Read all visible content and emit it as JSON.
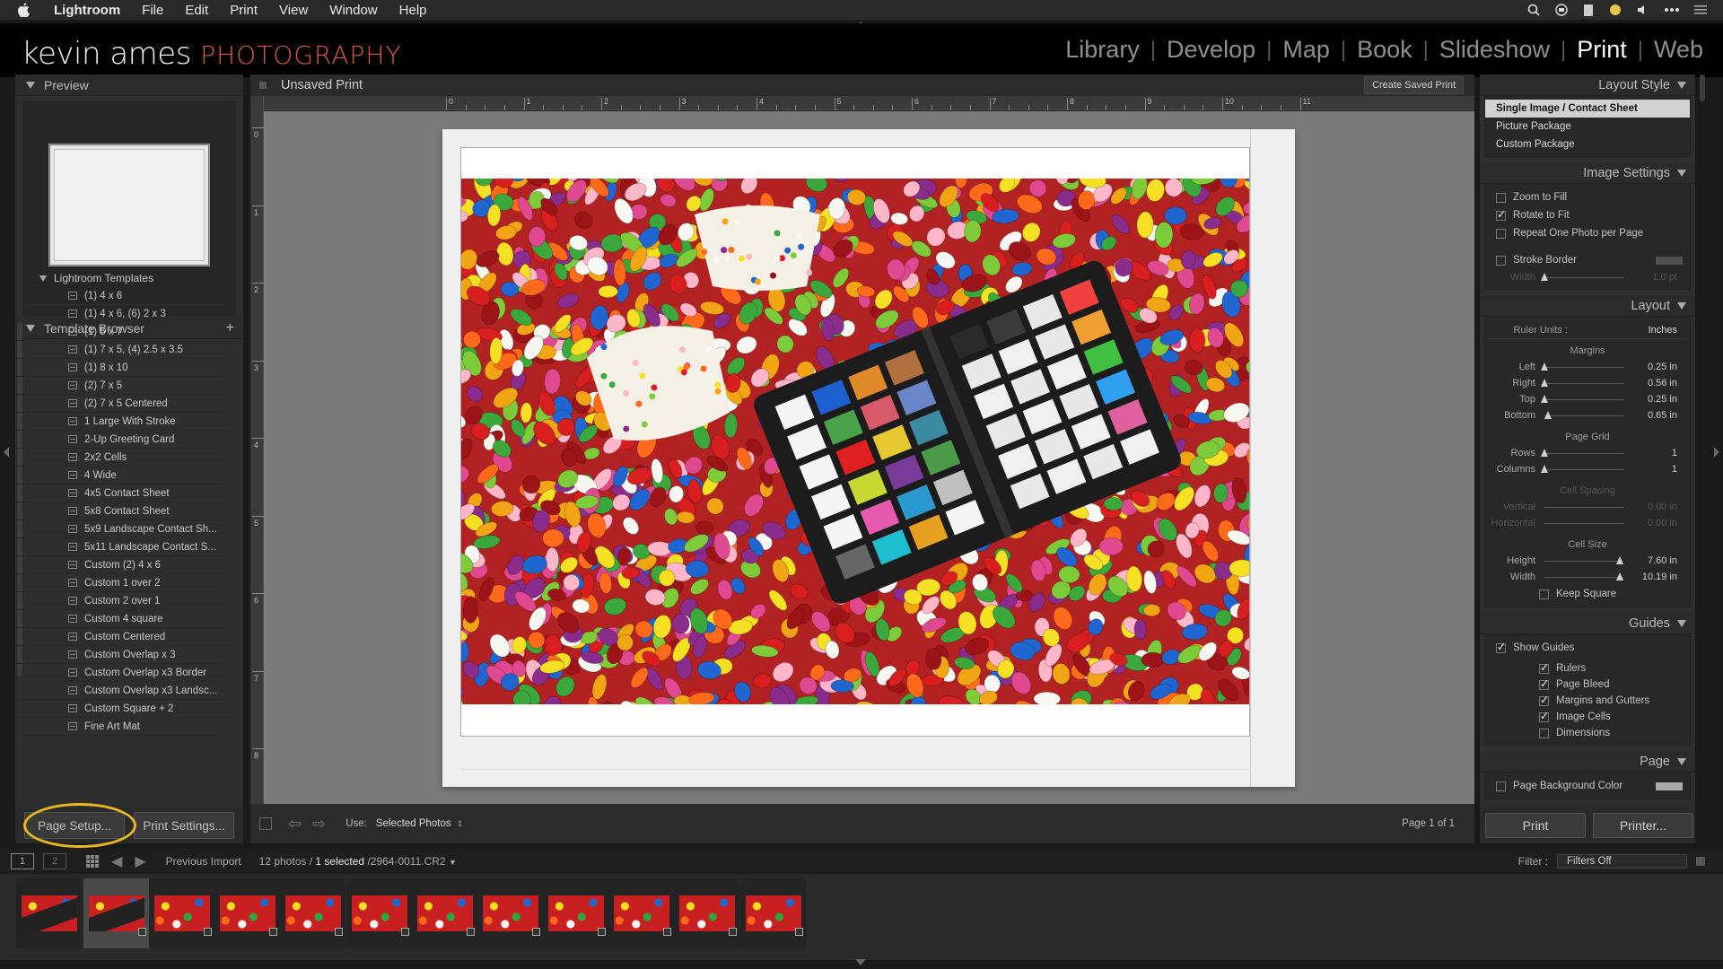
{
  "menubar": {
    "apple": "apple-icon",
    "items": [
      "Lightroom",
      "File",
      "Edit",
      "Print",
      "View",
      "Window",
      "Help"
    ],
    "status_icons": [
      "search-icon",
      "screen-icon",
      "doc-icon",
      "cloud-icon",
      "volume-icon",
      "more-icon",
      "list-icon"
    ]
  },
  "identity": {
    "brand_main": "kevin ames",
    "brand_accent": "PHOTOGRAPHY",
    "accent_color": "#e0563c"
  },
  "modules": [
    "Library",
    "Develop",
    "Map",
    "Book",
    "Slideshow",
    "Print",
    "Web"
  ],
  "active_module": "Print",
  "left": {
    "preview_title": "Preview",
    "template_browser_title": "Template Browser",
    "add_label": "+",
    "folder": "Lightroom Templates",
    "templates": [
      "(1) 4 x 6",
      "(1) 4 x 6, (6) 2 x 3",
      "(1) 5 x 7",
      "(1) 7 x 5, (4) 2.5 x 3.5",
      "(1) 8 x 10",
      "(2) 7 x 5",
      "(2) 7 x 5 Centered",
      "1 Large With Stroke",
      "2-Up Greeting Card",
      "2x2 Cells",
      "4 Wide",
      "4x5 Contact Sheet",
      "5x8 Contact Sheet",
      "5x9 Landscape Contact Sh...",
      "5x11 Landscape Contact S...",
      "Custom (2) 4 x 6",
      "Custom 1 over 2",
      "Custom 2 over 1",
      "Custom 4 square",
      "Custom Centered",
      "Custom Overlap x 3",
      "Custom Overlap x3 Border",
      "Custom Overlap x3 Landsc...",
      "Custom Square + 2",
      "Fine Art Mat"
    ],
    "page_setup": "Page Setup...",
    "print_settings": "Print Settings..."
  },
  "center": {
    "title": "Unsaved Print",
    "create_saved": "Create Saved Print",
    "ruler_h": [
      "0",
      "1",
      "2",
      "3",
      "4",
      "5",
      "6",
      "7",
      "8",
      "9",
      "10",
      "11"
    ],
    "ruler_v": [
      "0",
      "1",
      "2",
      "3",
      "4",
      "5",
      "6",
      "7",
      "8"
    ],
    "use_label": "Use:",
    "use_value": "Selected Photos",
    "page_info": "Page 1 of 1"
  },
  "right": {
    "layout_style": {
      "title": "Layout Style",
      "options": [
        "Single Image / Contact Sheet",
        "Picture Package",
        "Custom Package"
      ],
      "selected": 0
    },
    "image_settings": {
      "title": "Image Settings",
      "zoom_to_fill": "Zoom to Fill",
      "rotate_to_fit": "Rotate to Fit",
      "repeat_one": "Repeat One Photo per Page",
      "stroke_border": "Stroke Border",
      "width_label": "Width",
      "width_value": "1.0 pt"
    },
    "layout": {
      "title": "Layout",
      "ruler_units_label": "Ruler Units :",
      "ruler_units_value": "Inches",
      "margins_title": "Margins",
      "margins": [
        {
          "label": "Left",
          "value": "0.25 in",
          "frac": 0.0
        },
        {
          "label": "Right",
          "value": "0.56 in",
          "frac": 0.0
        },
        {
          "label": "Top",
          "value": "0.25 in",
          "frac": 0.0
        },
        {
          "label": "Bottom",
          "value": "0.65 in",
          "frac": 0.05
        }
      ],
      "page_grid_title": "Page Grid",
      "grid": [
        {
          "label": "Rows",
          "value": "1",
          "frac": 0.0
        },
        {
          "label": "Columns",
          "value": "1",
          "frac": 0.0
        }
      ],
      "cell_spacing_title": "Cell Spacing",
      "spacing": [
        {
          "label": "Vertical",
          "value": "0.00 in",
          "frac": 0.0
        },
        {
          "label": "Horizontal",
          "value": "0.00 in",
          "frac": 0.0
        }
      ],
      "cell_size_title": "Cell Size",
      "cell_size": [
        {
          "label": "Height",
          "value": "7.60 in",
          "frac": 0.96
        },
        {
          "label": "Width",
          "value": "10.19 in",
          "frac": 0.96
        }
      ],
      "keep_square": "Keep Square"
    },
    "guides": {
      "title": "Guides",
      "show_guides": "Show Guides",
      "items": [
        "Rulers",
        "Page Bleed",
        "Margins and Gutters",
        "Image Cells",
        "Dimensions"
      ],
      "checked": [
        true,
        true,
        true,
        true,
        false
      ]
    },
    "page": {
      "title": "Page",
      "bg_color": "Page Background Color"
    },
    "print": "Print",
    "printer": "Printer..."
  },
  "filmstrip_bar": {
    "monitor1": "1",
    "monitor2": "2",
    "source": "Previous Import",
    "count_prefix": "12 photos /",
    "count_selected": "1 selected",
    "count_file": "/2964-0011.CR2",
    "filter_label": "Filter :",
    "filter_value": "Filters Off"
  },
  "filmstrip": {
    "count": 12,
    "selected_index": 1
  }
}
